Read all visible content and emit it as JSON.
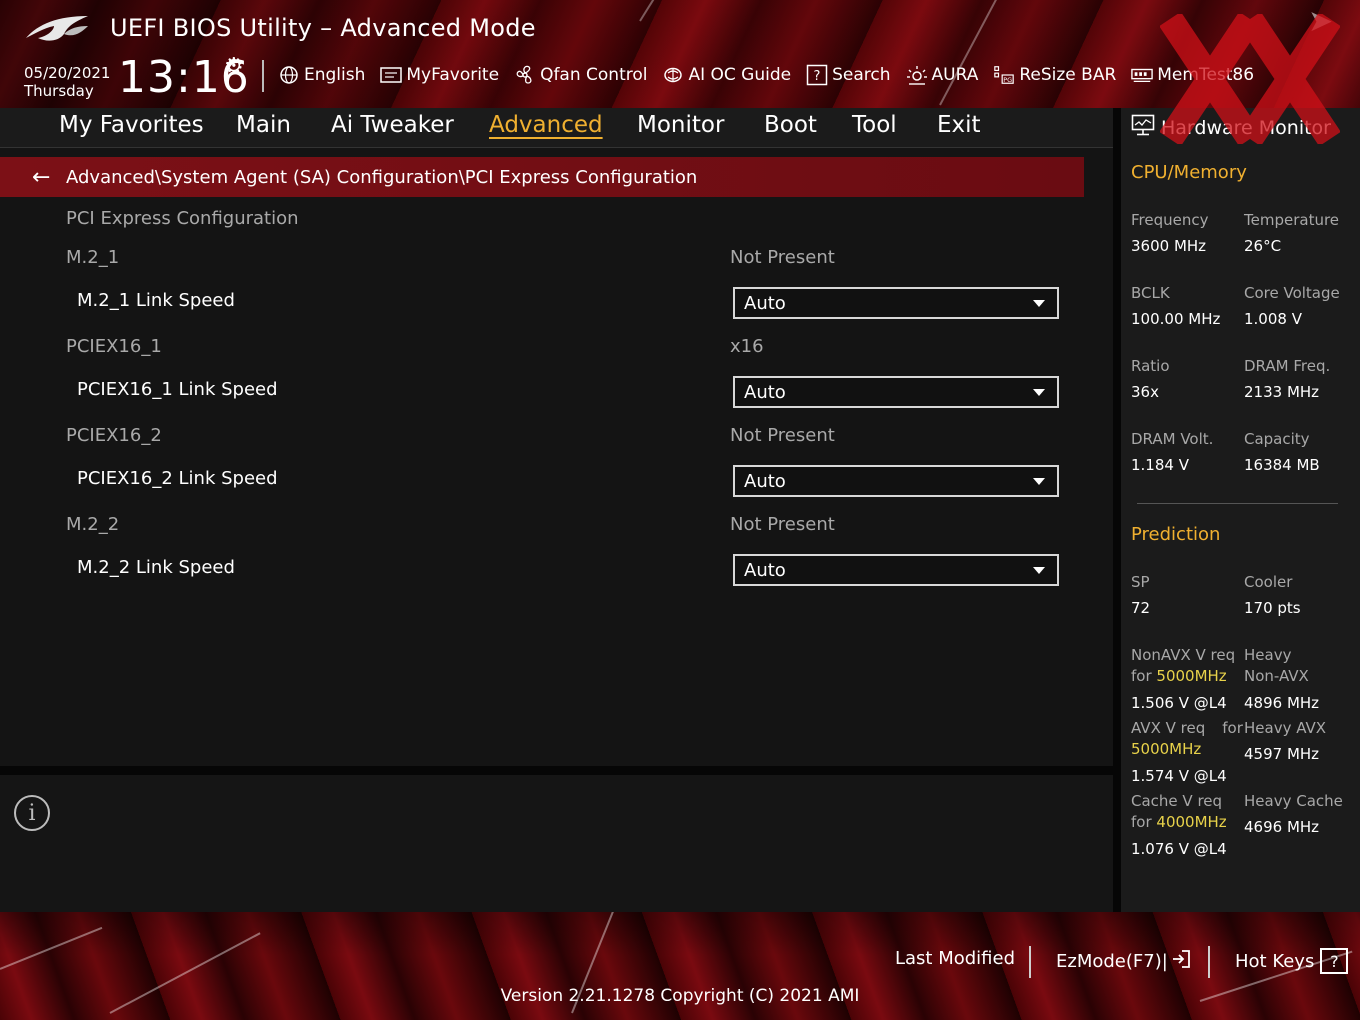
{
  "header": {
    "title": "UEFI BIOS Utility – Advanced Mode",
    "date": "05/20/2021",
    "day": "Thursday",
    "time": "13:16",
    "tools": [
      {
        "label": "English",
        "icon": "globe-icon"
      },
      {
        "label": "MyFavorite",
        "icon": "favorite-icon"
      },
      {
        "label": "Qfan Control",
        "icon": "fan-icon"
      },
      {
        "label": "AI OC Guide",
        "icon": "ai-oc-icon"
      },
      {
        "label": "Search",
        "icon": "search-help-icon"
      },
      {
        "label": "AURA",
        "icon": "aura-icon"
      },
      {
        "label": "ReSize BAR",
        "icon": "resize-bar-icon"
      },
      {
        "label": "MemTest86",
        "icon": "memtest-icon"
      }
    ]
  },
  "nav": {
    "tabs": [
      {
        "label": "My Favorites"
      },
      {
        "label": "Main"
      },
      {
        "label": "Ai Tweaker"
      },
      {
        "label": "Advanced",
        "active": true
      },
      {
        "label": "Monitor"
      },
      {
        "label": "Boot"
      },
      {
        "label": "Tool"
      },
      {
        "label": "Exit"
      }
    ]
  },
  "main": {
    "breadcrumb": "Advanced\\System Agent (SA) Configuration\\PCI Express Configuration",
    "section_title": "PCI Express Configuration",
    "rows": [
      {
        "label": "M.2_1",
        "value": "Not Present",
        "item_label": "M.2_1 Link Speed",
        "setting": "Auto"
      },
      {
        "label": "PCIEX16_1",
        "value": "x16",
        "item_label": "PCIEX16_1 Link Speed",
        "setting": "Auto"
      },
      {
        "label": "PCIEX16_2",
        "value": "Not Present",
        "item_label": "PCIEX16_2 Link Speed",
        "setting": "Auto"
      },
      {
        "label": "M.2_2",
        "value": "Not Present",
        "item_label": "M.2_2 Link Speed",
        "setting": "Auto"
      }
    ]
  },
  "hw_monitor": {
    "title": "Hardware Monitor",
    "cpu_memory_title": "CPU/Memory",
    "cpu_memory": [
      {
        "label": "Frequency",
        "value": "3600 MHz"
      },
      {
        "label": "Temperature",
        "value": "26°C"
      },
      {
        "label": "BCLK",
        "value": "100.00 MHz"
      },
      {
        "label": "Core Voltage",
        "value": "1.008 V"
      },
      {
        "label": "Ratio",
        "value": "36x"
      },
      {
        "label": "DRAM Freq.",
        "value": "2133 MHz"
      },
      {
        "label": "DRAM Volt.",
        "value": "1.184 V"
      },
      {
        "label": "Capacity",
        "value": "16384 MB"
      }
    ],
    "prediction_title": "Prediction",
    "prediction": {
      "sp_label": "SP",
      "sp_value": "72",
      "cooler_label": "Cooler",
      "cooler_value": "170 pts",
      "nonavx_label_1": "NonAVX V req",
      "nonavx_label_2": "for",
      "nonavx_freq": "5000MHz",
      "nonavx_value": "1.506 V @L4",
      "heavy_nonavx_label_1": "Heavy",
      "heavy_nonavx_label_2": "Non-AVX",
      "heavy_nonavx_value": "4896 MHz",
      "avx_label_1": "AVX V req",
      "avx_label_2": "for",
      "avx_freq": "5000MHz",
      "avx_value": "1.574 V @L4",
      "heavy_avx_label": "Heavy AVX",
      "heavy_avx_value": "4597 MHz",
      "cache_label_1": "Cache V req",
      "cache_label_2": "for",
      "cache_freq": "4000MHz",
      "cache_value": "1.076 V @L4",
      "heavy_cache_label": "Heavy Cache",
      "heavy_cache_value": "4696 MHz"
    }
  },
  "footer": {
    "last_modified": "Last Modified",
    "ezmode": "EzMode(F7)|",
    "hot_keys": "Hot Keys",
    "hot_keys_box": "?",
    "version": "Version 2.21.1278 Copyright (C) 2021 AMI"
  },
  "colors": {
    "accent": "#f0b030",
    "highlight": "#e8d24a",
    "breadcrumb_bg": "#7c1016"
  }
}
